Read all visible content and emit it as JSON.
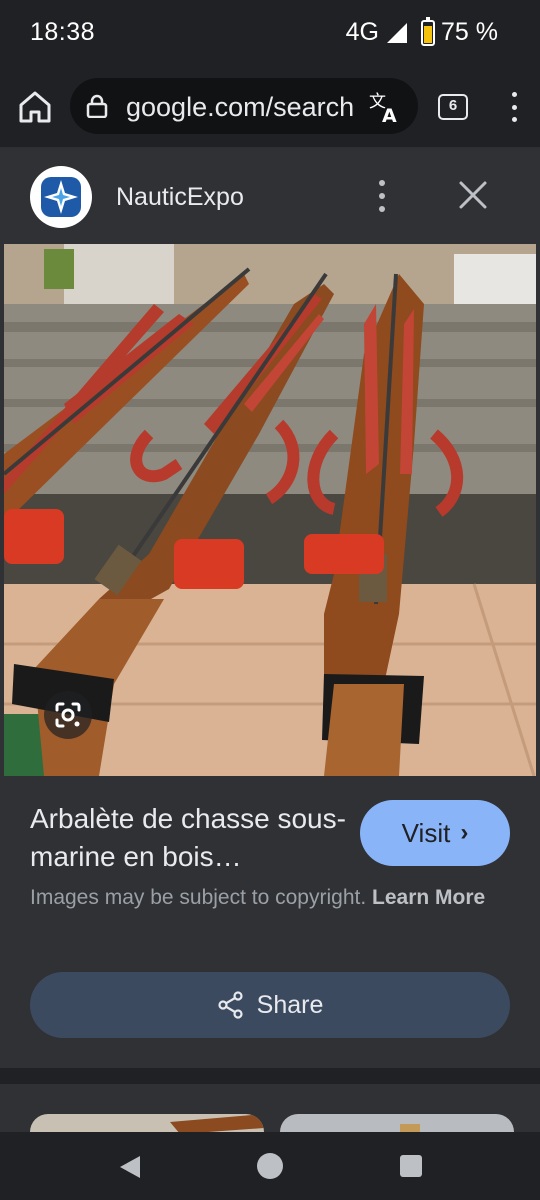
{
  "status_bar": {
    "time": "18:38",
    "network": "4G",
    "battery": "75 %",
    "battery_level": 0.75
  },
  "toolbar": {
    "url": "google.com/search",
    "tab_count": "6",
    "icons": [
      "home-icon",
      "lock-icon",
      "translate-icon",
      "more-vert-icon"
    ]
  },
  "source": {
    "name": "NauticExpo",
    "icons": [
      "nauticexpo-logo",
      "more-vert-icon",
      "close-icon"
    ]
  },
  "result": {
    "title": "Arbalète de chasse sous-marine en bois…",
    "visit_label": "Visit",
    "copyright_text": "Images may be subject to copyright.",
    "learn_more": "Learn More",
    "share_label": "Share"
  },
  "colors": {
    "background": "#202124",
    "panel": "#303134",
    "visit_button": "#8ab4f8",
    "share_button": "#3c4a60"
  }
}
